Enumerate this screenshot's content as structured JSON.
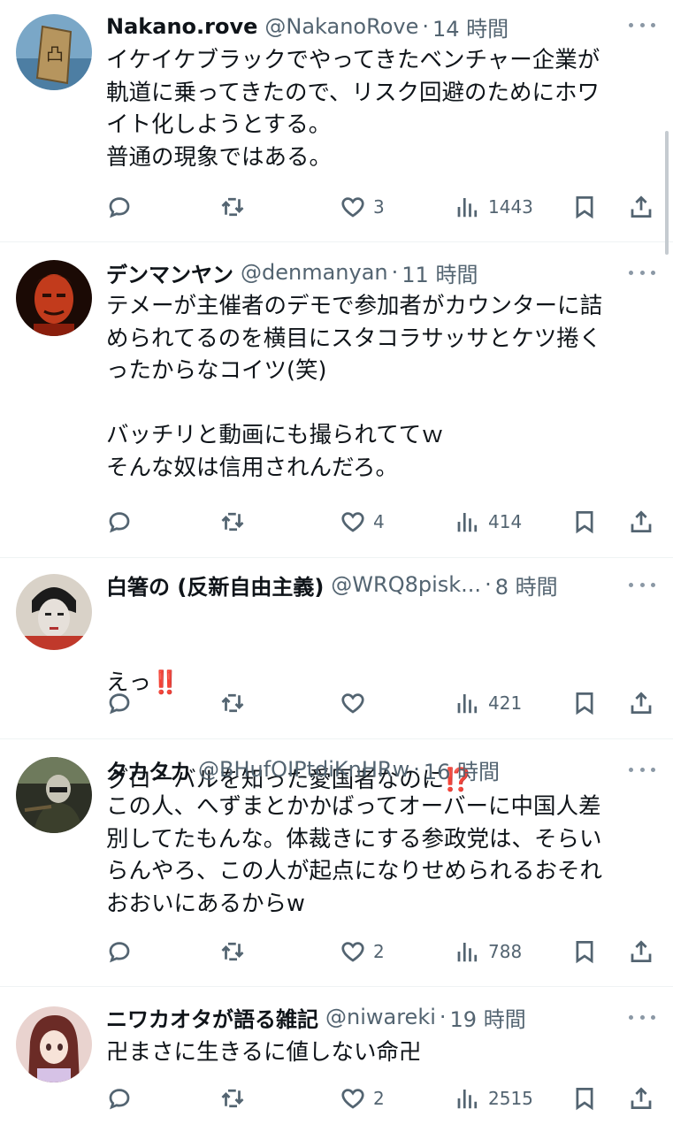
{
  "tweets": [
    {
      "name": "Nakano.rove",
      "handle": "@NakanoRove",
      "time": "14 時間",
      "body": "イケイケブラックでやってきたベンチャー企業が\n軌道に乗ってきたので、リスク回避のためにホワ\nイト化しようとする。\n普通の現象ではある。",
      "likes": "3",
      "views": "1443"
    },
    {
      "name": "デンマンヤン",
      "handle": "@denmanyan",
      "time": "11 時間",
      "body": "テメーが主催者のデモで参加者がカウンターに詰\nめられてるのを横目にスタコラサッサとケツ捲く\nったからなコイツ(笑)\n\nバッチリと動画にも撮られててｗ\nそんな奴は信用されんだろ。",
      "likes": "4",
      "views": "414"
    },
    {
      "name": "白箸の (反新自由主義)",
      "handle": "@WRQ8pisk...",
      "time": "8 時間",
      "body_line1": "えっ",
      "body_line1_emoji": "‼️",
      "body_line2": "グローバルを知った愛国者なのに",
      "body_line2_emoji": "⁉️",
      "likes": "",
      "views": "421"
    },
    {
      "name": "タカタカ",
      "handle": "@BHufOIPtdiKnHRw",
      "time": "16 時間",
      "body": "この人、へずまとかかばってオーバーに中国人差\n別してたもんな。体裁きにする参政党は、そらい\nらんやろ、この人が起点になりせめられるおそれ\nおおいにあるからw",
      "likes": "2",
      "views": "788"
    },
    {
      "name": "ニワカオタが語る雑記",
      "handle": "@niwareki",
      "time": "19 時間",
      "body": "卍まさに生きるに値しない命卍",
      "likes": "2",
      "views": "2515"
    }
  ],
  "icons": {
    "reply": "reply-icon",
    "retweet": "retweet-icon",
    "like": "heart-icon",
    "views": "views-icon",
    "bookmark": "bookmark-icon",
    "share": "share-icon",
    "more": "more-icon"
  }
}
